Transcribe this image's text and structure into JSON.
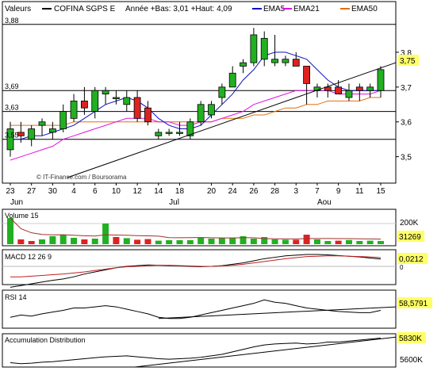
{
  "header": {
    "valeurs_label": "Valeurs",
    "name": "COFINA SGPS E",
    "range_text": "Année +Bas: 3,01 +Haut: 4,09",
    "ema5": "EMA5",
    "ema21": "EMA21",
    "ema50": "EMA50"
  },
  "colors": {
    "up": "#22b022",
    "down": "#dd2222",
    "ema5": "#1010c0",
    "ema21": "#e010e0",
    "ema50": "#e07010",
    "price_tag": "#ffff66",
    "watermark": "#333333"
  },
  "watermark": "© IT-Finance.com / Boursorama",
  "price_axis": {
    "ticks": [
      "3,8",
      "3,7",
      "3,6",
      "3,5"
    ],
    "levels": [
      "3,88",
      "3,69",
      "3,63",
      "3,55"
    ],
    "last_value": "3,75"
  },
  "x_axis": {
    "day_labels": [
      "23",
      "27",
      "30",
      "4",
      "6",
      "10",
      "12",
      "14",
      "18",
      "20",
      "24",
      "26",
      "28",
      "3",
      "7",
      "9",
      "11",
      "15"
    ],
    "month_labels": [
      "Jun",
      "Jul",
      "Aou"
    ]
  },
  "volume": {
    "title": "Volume 15",
    "max_tick": "200K",
    "last_value": "31269"
  },
  "macd": {
    "title": "MACD 12 26 9",
    "last_value": "0,0212",
    "zero_tick": "0"
  },
  "rsi": {
    "title": "RSI 14",
    "last_value": "58,5791"
  },
  "accdist": {
    "title": "Accumulation Distribution",
    "last_value": "5830K",
    "low_tick": "5600K"
  },
  "chart_data": {
    "type": "candlestick",
    "title": "COFINA SGPS E",
    "y_range": [
      3.44,
      3.9
    ],
    "candles": [
      {
        "o": 3.52,
        "h": 3.6,
        "l": 3.5,
        "c": 3.58
      },
      {
        "o": 3.57,
        "h": 3.6,
        "l": 3.54,
        "c": 3.56
      },
      {
        "o": 3.55,
        "h": 3.59,
        "l": 3.53,
        "c": 3.58
      },
      {
        "o": 3.59,
        "h": 3.61,
        "l": 3.56,
        "c": 3.6
      },
      {
        "o": 3.57,
        "h": 3.6,
        "l": 3.55,
        "c": 3.58
      },
      {
        "o": 3.58,
        "h": 3.65,
        "l": 3.57,
        "c": 3.63
      },
      {
        "o": 3.61,
        "h": 3.68,
        "l": 3.6,
        "c": 3.66
      },
      {
        "o": 3.66,
        "h": 3.7,
        "l": 3.62,
        "c": 3.64
      },
      {
        "o": 3.63,
        "h": 3.7,
        "l": 3.61,
        "c": 3.69
      },
      {
        "o": 3.68,
        "h": 3.7,
        "l": 3.65,
        "c": 3.69
      },
      {
        "o": 3.67,
        "h": 3.69,
        "l": 3.65,
        "c": 3.67
      },
      {
        "o": 3.65,
        "h": 3.69,
        "l": 3.63,
        "c": 3.67
      },
      {
        "o": 3.67,
        "h": 3.69,
        "l": 3.6,
        "c": 3.61
      },
      {
        "o": 3.64,
        "h": 3.66,
        "l": 3.59,
        "c": 3.6
      },
      {
        "o": 3.56,
        "h": 3.58,
        "l": 3.55,
        "c": 3.57
      },
      {
        "o": 3.57,
        "h": 3.58,
        "l": 3.56,
        "c": 3.57
      },
      {
        "o": 3.57,
        "h": 3.6,
        "l": 3.56,
        "c": 3.57
      },
      {
        "o": 3.56,
        "h": 3.61,
        "l": 3.55,
        "c": 3.6
      },
      {
        "o": 3.6,
        "h": 3.66,
        "l": 3.59,
        "c": 3.65
      },
      {
        "o": 3.62,
        "h": 3.66,
        "l": 3.61,
        "c": 3.65
      },
      {
        "o": 3.67,
        "h": 3.71,
        "l": 3.65,
        "c": 3.7
      },
      {
        "o": 3.7,
        "h": 3.76,
        "l": 3.7,
        "c": 3.74
      },
      {
        "o": 3.76,
        "h": 3.78,
        "l": 3.74,
        "c": 3.77
      },
      {
        "o": 3.77,
        "h": 3.87,
        "l": 3.76,
        "c": 3.85
      },
      {
        "o": 3.78,
        "h": 3.86,
        "l": 3.76,
        "c": 3.84
      },
      {
        "o": 3.77,
        "h": 3.85,
        "l": 3.76,
        "c": 3.78
      },
      {
        "o": 3.77,
        "h": 3.79,
        "l": 3.76,
        "c": 3.78
      },
      {
        "o": 3.78,
        "h": 3.8,
        "l": 3.76,
        "c": 3.76
      },
      {
        "o": 3.76,
        "h": 3.76,
        "l": 3.65,
        "c": 3.71
      },
      {
        "o": 3.69,
        "h": 3.71,
        "l": 3.67,
        "c": 3.7
      },
      {
        "o": 3.7,
        "h": 3.71,
        "l": 3.67,
        "c": 3.69
      },
      {
        "o": 3.7,
        "h": 3.72,
        "l": 3.69,
        "c": 3.68
      },
      {
        "o": 3.67,
        "h": 3.71,
        "l": 3.66,
        "c": 3.69
      },
      {
        "o": 3.7,
        "h": 3.71,
        "l": 3.66,
        "c": 3.69
      },
      {
        "o": 3.69,
        "h": 3.71,
        "l": 3.67,
        "c": 3.7
      },
      {
        "o": 3.69,
        "h": 3.76,
        "l": 3.67,
        "c": 3.75
      }
    ],
    "ema5": [
      3.55,
      3.55,
      3.56,
      3.56,
      3.57,
      3.58,
      3.59,
      3.61,
      3.63,
      3.65,
      3.66,
      3.67,
      3.66,
      3.64,
      3.61,
      3.59,
      3.58,
      3.58,
      3.59,
      3.62,
      3.65,
      3.68,
      3.72,
      3.75,
      3.79,
      3.8,
      3.8,
      3.79,
      3.78,
      3.75,
      3.72,
      3.7,
      3.69,
      3.69,
      3.69,
      3.69
    ],
    "ema21": [
      3.49,
      3.5,
      3.51,
      3.52,
      3.53,
      3.55,
      3.56,
      3.57,
      3.58,
      3.59,
      3.6,
      3.61,
      3.61,
      3.61,
      3.6,
      3.6,
      3.59,
      3.59,
      3.6,
      3.6,
      3.61,
      3.62,
      3.63,
      3.65,
      3.66,
      3.67,
      3.68,
      3.69,
      3.69,
      3.69,
      3.69,
      3.68,
      3.68,
      3.68,
      3.68,
      3.69
    ],
    "ema50": [
      3.59,
      3.59,
      3.59,
      3.59,
      3.59,
      3.59,
      3.6,
      3.6,
      3.6,
      3.6,
      3.6,
      3.6,
      3.6,
      3.6,
      3.6,
      3.6,
      3.6,
      3.6,
      3.6,
      3.6,
      3.61,
      3.61,
      3.61,
      3.62,
      3.62,
      3.63,
      3.64,
      3.64,
      3.65,
      3.65,
      3.66,
      3.66,
      3.66,
      3.66,
      3.67,
      3.67
    ],
    "volume": [
      165,
      30,
      20,
      30,
      50,
      60,
      40,
      30,
      35,
      130,
      45,
      38,
      28,
      32,
      22,
      25,
      25,
      25,
      42,
      35,
      40,
      38,
      50,
      35,
      45,
      30,
      28,
      28,
      60,
      30,
      20,
      22,
      26,
      20,
      22,
      20
    ],
    "volume_up": [
      true,
      false,
      false,
      true,
      true,
      true,
      true,
      false,
      true,
      true,
      false,
      true,
      false,
      false,
      true,
      true,
      true,
      true,
      true,
      true,
      true,
      true,
      true,
      true,
      true,
      true,
      true,
      false,
      false,
      true,
      true,
      false,
      true,
      true,
      true,
      true
    ],
    "macd": [
      -0.06,
      -0.055,
      -0.05,
      -0.045,
      -0.04,
      -0.036,
      -0.03,
      -0.022,
      -0.016,
      -0.01,
      -0.004,
      0.0,
      0.002,
      0.004,
      0.003,
      0.002,
      0.001,
      0.0,
      -0.001,
      0.0,
      0.002,
      0.006,
      0.01,
      0.016,
      0.022,
      0.026,
      0.03,
      0.032,
      0.034,
      0.034,
      0.033,
      0.031,
      0.029,
      0.027,
      0.024,
      0.021
    ],
    "macd_signal": [
      -0.03,
      -0.03,
      -0.028,
      -0.026,
      -0.024,
      -0.022,
      -0.019,
      -0.016,
      -0.012,
      -0.008,
      -0.004,
      -0.001,
      0.0,
      0.002,
      0.003,
      0.003,
      0.002,
      0.001,
      0.0,
      0.0,
      0.001,
      0.003,
      0.006,
      0.01,
      0.014,
      0.018,
      0.022,
      0.025,
      0.028,
      0.029,
      0.03,
      0.03,
      0.029,
      0.028,
      0.027,
      0.025
    ],
    "rsi": [
      46,
      50,
      48,
      52,
      55,
      58,
      62,
      62,
      64,
      66,
      64,
      60,
      56,
      52,
      46,
      44,
      44,
      46,
      50,
      54,
      58,
      62,
      66,
      70,
      76,
      72,
      70,
      66,
      62,
      60,
      58,
      56,
      55,
      54,
      54,
      58
    ],
    "accdist": [
      5580,
      5570,
      5575,
      5585,
      5590,
      5600,
      5610,
      5620,
      5630,
      5640,
      5645,
      5650,
      5640,
      5630,
      5620,
      5615,
      5620,
      5625,
      5635,
      5650,
      5665,
      5690,
      5715,
      5740,
      5760,
      5770,
      5775,
      5780,
      5770,
      5775,
      5790,
      5790,
      5800,
      5810,
      5820,
      5830
    ]
  }
}
